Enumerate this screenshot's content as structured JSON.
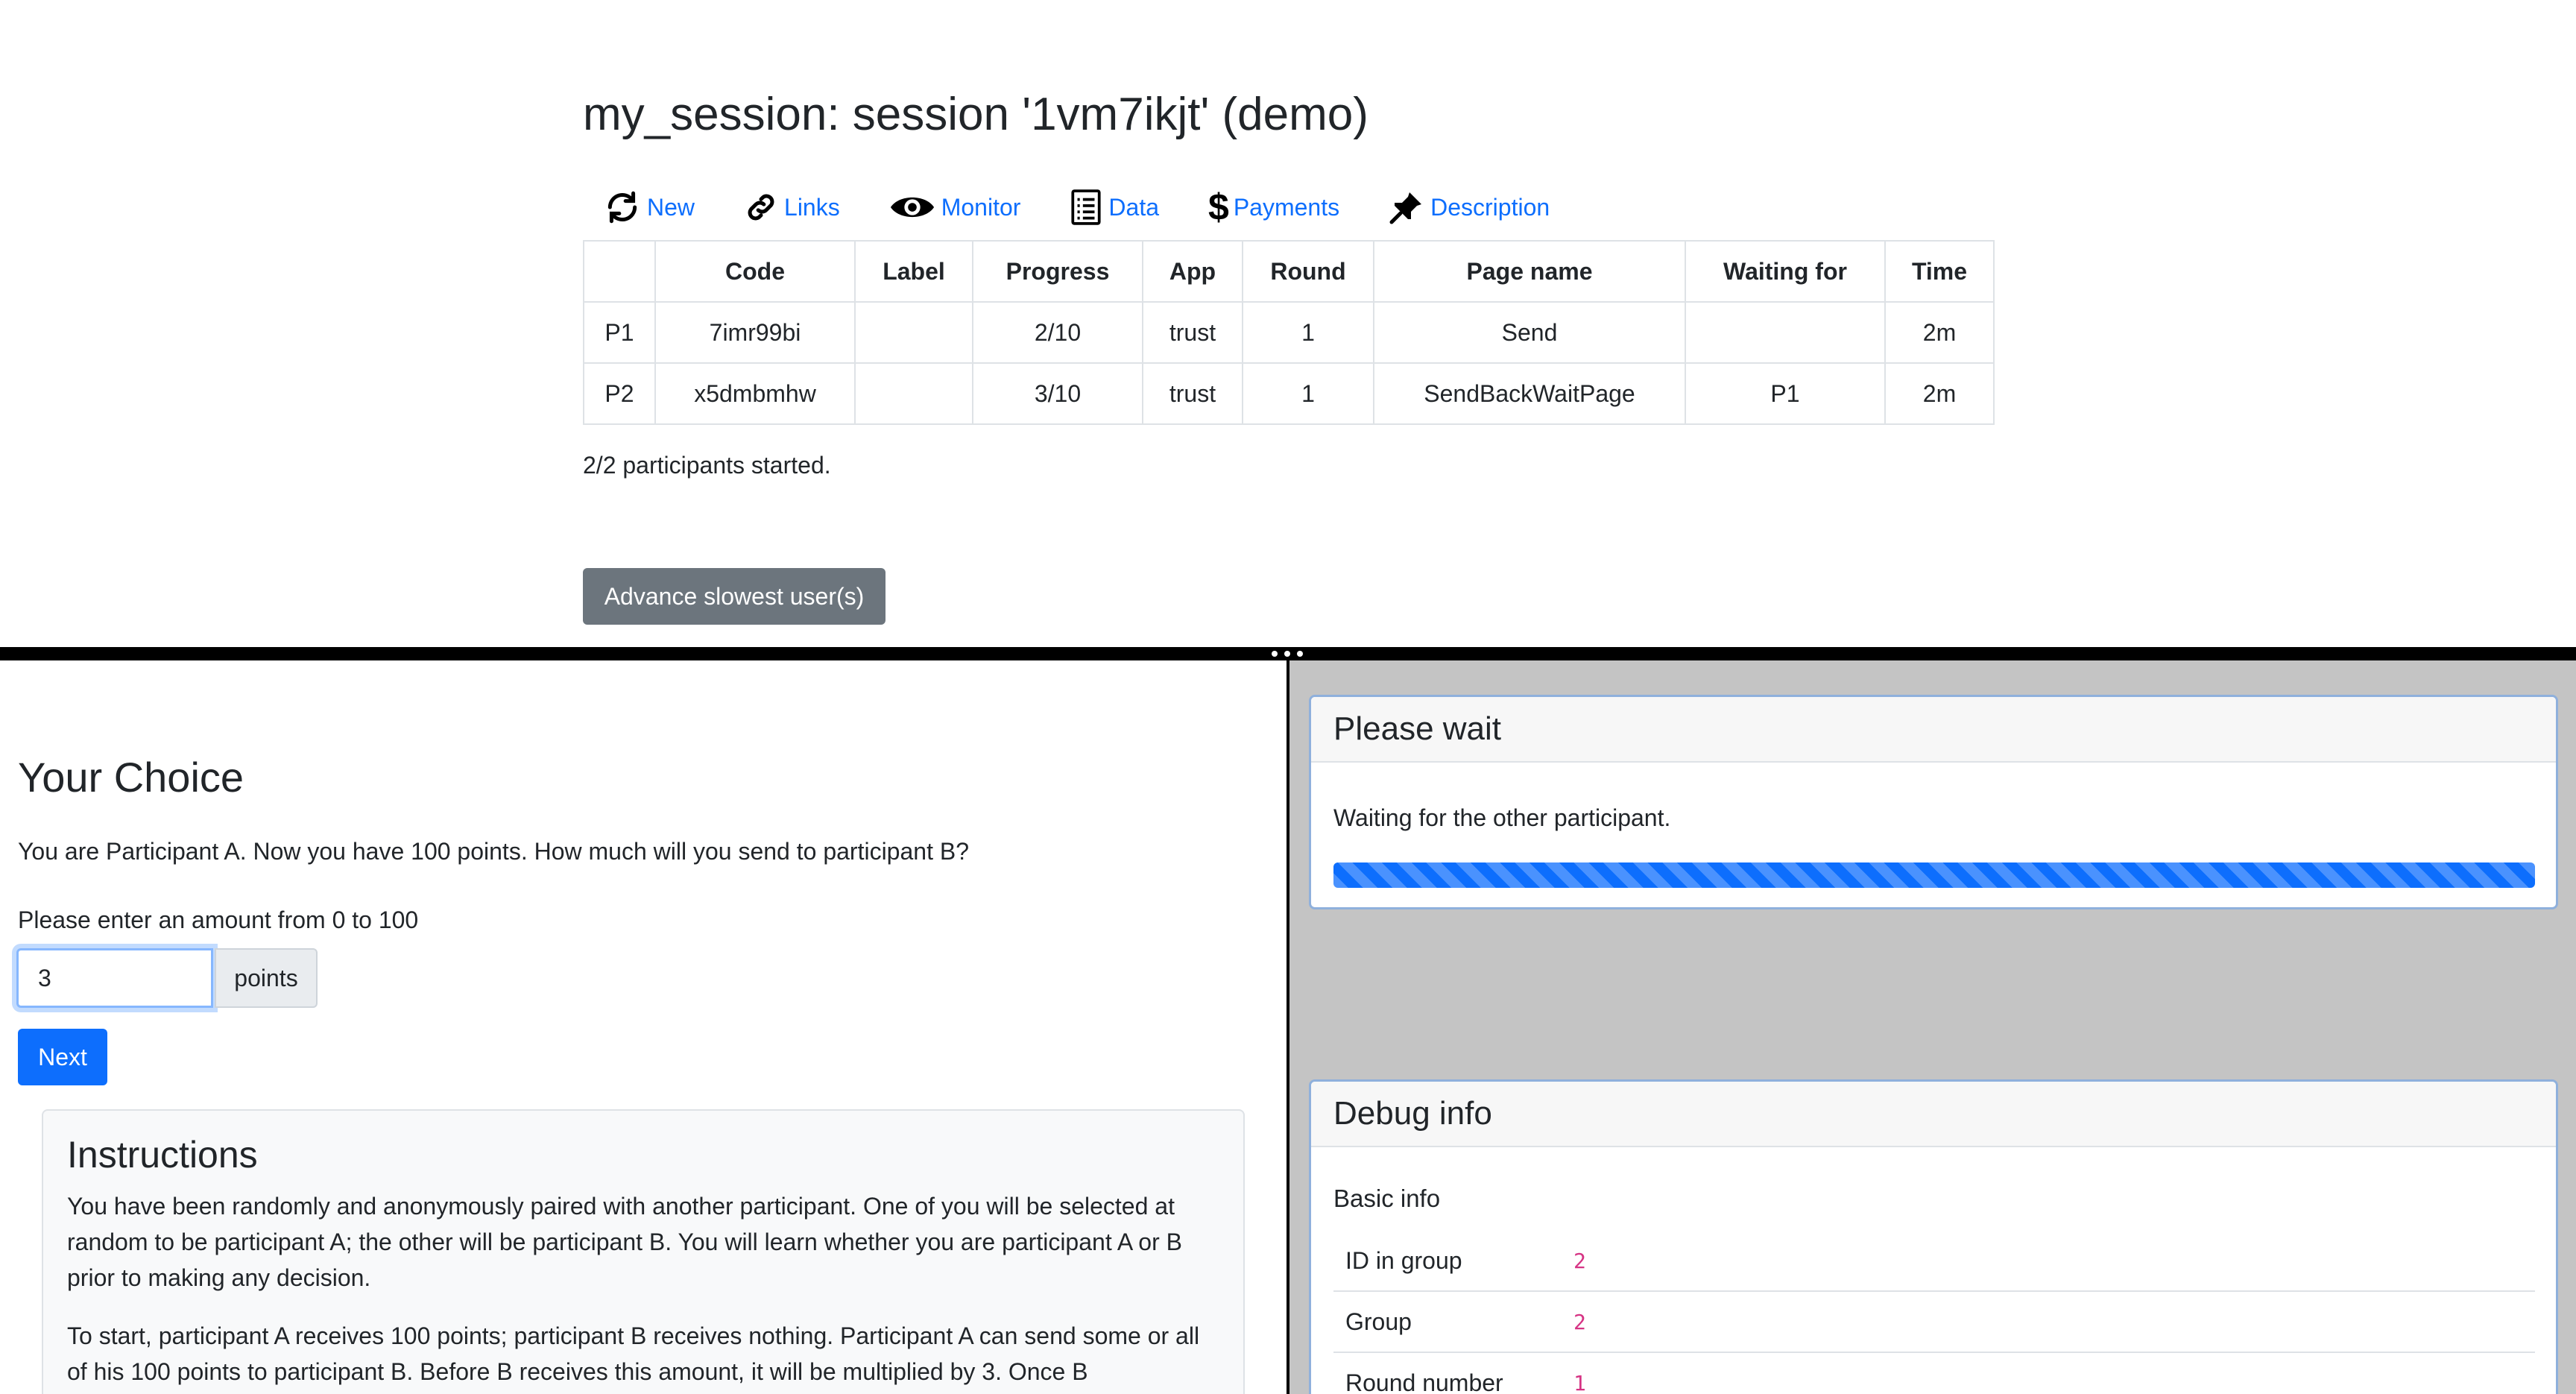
{
  "session": {
    "title": "my_session: session '1vm7ikjt' (demo)"
  },
  "nav": [
    {
      "label": "New",
      "icon": "refresh-icon"
    },
    {
      "label": "Links",
      "icon": "link-icon"
    },
    {
      "label": "Monitor",
      "icon": "eye-icon"
    },
    {
      "label": "Data",
      "icon": "list-icon"
    },
    {
      "label": "Payments",
      "icon": "dollar-icon"
    },
    {
      "label": "Description",
      "icon": "pin-icon"
    }
  ],
  "monitor_table": {
    "headers": [
      "",
      "Code",
      "Label",
      "Progress",
      "App",
      "Round",
      "Page name",
      "Waiting for",
      "Time"
    ],
    "rows": [
      [
        "P1",
        "7imr99bi",
        "",
        "2/10",
        "trust",
        "1",
        "Send",
        "",
        "2m"
      ],
      [
        "P2",
        "x5dmbmhw",
        "",
        "3/10",
        "trust",
        "1",
        "SendBackWaitPage",
        "P1",
        "2m"
      ]
    ]
  },
  "status": {
    "started": "2/2 participants started."
  },
  "advance_button": "Advance slowest user(s)",
  "left": {
    "title": "Your Choice",
    "question": "You are Participant A. Now you have 100 points. How much will you send to participant B?",
    "amount_label": "Please enter an amount from 0 to 100",
    "amount_value": "3",
    "amount_addon": "points",
    "next_label": "Next",
    "instructions": {
      "title": "Instructions",
      "p1": "You have been randomly and anonymously paired with another participant. One of you will be selected at random to be participant A; the other will be participant B. You will learn whether you are participant A or B prior to making any decision.",
      "p2": "To start, participant A receives 100 points; participant B receives nothing. Participant A can send some or all of his 100 points to participant B. Before B receives this amount, it will be multiplied by 3. Once B"
    }
  },
  "right": {
    "wait_title": "Please wait",
    "wait_text": "Waiting for the other participant.",
    "progress": 1.0,
    "debug_title": "Debug info",
    "basic_info": "Basic info",
    "debug_rows": [
      {
        "key": "ID in group",
        "value": "2"
      },
      {
        "key": "Group",
        "value": "2"
      },
      {
        "key": "Round number",
        "value": "1"
      }
    ]
  },
  "colors": {
    "link": "#0d6efd",
    "primary_button": "#0d6efd",
    "secondary_button": "#6c757d",
    "right_bg": "#c4c4c4",
    "debug_value": "#d63384"
  }
}
